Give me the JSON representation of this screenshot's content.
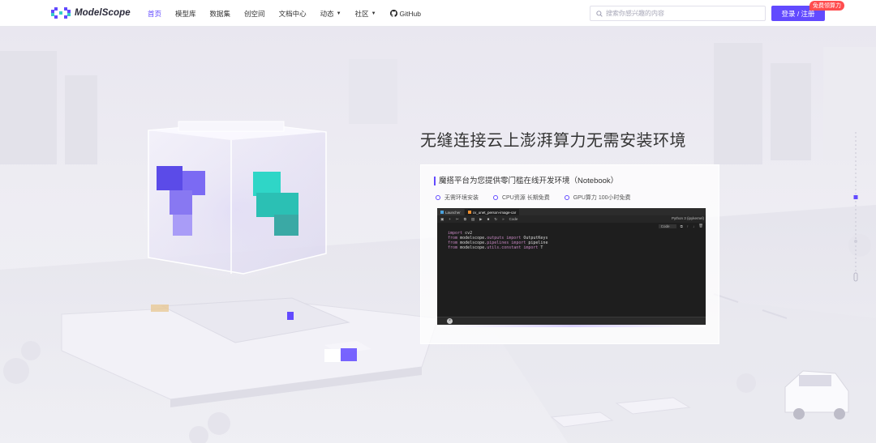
{
  "logo": {
    "text": "ModelScope"
  },
  "nav": {
    "items": [
      {
        "label": "首页",
        "active": true
      },
      {
        "label": "模型库"
      },
      {
        "label": "数据集"
      },
      {
        "label": "创空间"
      },
      {
        "label": "文档中心"
      },
      {
        "label": "动态",
        "dropdown": true
      },
      {
        "label": "社区",
        "dropdown": true
      },
      {
        "label": "GitHub",
        "icon": "github-icon"
      }
    ]
  },
  "search": {
    "placeholder": "搜索你感兴趣的内容"
  },
  "login": {
    "label": "登录 / 注册",
    "badge": "免费领算力"
  },
  "hero": {
    "headline": "无缝连接云上澎湃算力无需安装环境",
    "card_title": "魔搭平台为您提供零门槛在线开发环境（Notebook）",
    "features": [
      "无需环境安装",
      "CPU资源 长期免费",
      "GPU算力 100小时免费"
    ]
  },
  "editor": {
    "tabs": [
      "Launcher",
      "cv_unet_person-image-car"
    ],
    "toolbar_mode": "Code",
    "kernel": "Python 3 (ipykernel)",
    "cell_type": "Code",
    "code_lines": [
      [
        {
          "t": "import ",
          "c": "kw"
        },
        {
          "t": "cv2",
          "c": "mod"
        }
      ],
      [
        {
          "t": "from ",
          "c": "kw"
        },
        {
          "t": "modelscope.",
          "c": "mod"
        },
        {
          "t": "outputs ",
          "c": "mem"
        },
        {
          "t": "import ",
          "c": "kw"
        },
        {
          "t": "OutputKeys",
          "c": "mod"
        }
      ],
      [
        {
          "t": "from ",
          "c": "kw"
        },
        {
          "t": "modelscope.",
          "c": "mod"
        },
        {
          "t": "pipelines ",
          "c": "mem"
        },
        {
          "t": "import ",
          "c": "kw"
        },
        {
          "t": "pipeline",
          "c": "mod"
        }
      ],
      [
        {
          "t": "from ",
          "c": "kw"
        },
        {
          "t": "modelscope.",
          "c": "mod"
        },
        {
          "t": "utils.constant ",
          "c": "mem"
        },
        {
          "t": "import ",
          "c": "kw"
        },
        {
          "t": "T",
          "c": "mod"
        }
      ]
    ]
  },
  "colors": {
    "accent": "#624aff",
    "badge": "#ff4d4f"
  }
}
